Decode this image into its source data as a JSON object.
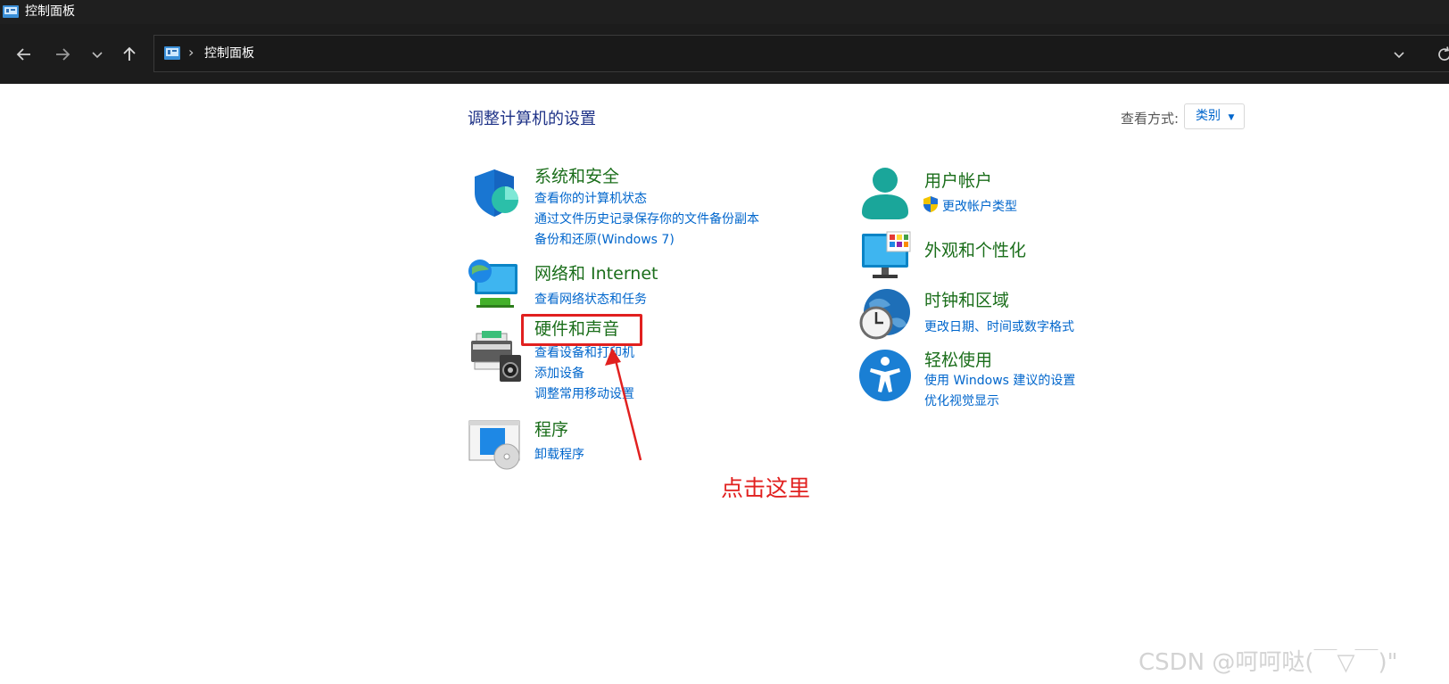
{
  "window": {
    "title": "控制面板"
  },
  "toolbar": {
    "back_icon": "arrow-left-icon",
    "forward_icon": "arrow-right-icon",
    "recent_icon": "chevron-down-icon",
    "up_icon": "arrow-up-icon"
  },
  "address": {
    "crumb": "控制面板"
  },
  "main": {
    "heading": "调整计算机的设置",
    "view_by_label": "查看方式:",
    "view_by_value": "类别"
  },
  "categories": {
    "system": {
      "title": "系统和安全",
      "links": [
        "查看你的计算机状态",
        "通过文件历史记录保存你的文件备份副本",
        "备份和还原(Windows 7)"
      ]
    },
    "network": {
      "title": "网络和 Internet",
      "links": [
        "查看网络状态和任务"
      ]
    },
    "hardware": {
      "title": "硬件和声音",
      "links": [
        "查看设备和打印机",
        "添加设备",
        "调整常用移动设置"
      ]
    },
    "programs": {
      "title": "程序",
      "links": [
        "卸载程序"
      ]
    },
    "accounts": {
      "title": "用户帐户",
      "links": [
        "更改帐户类型"
      ]
    },
    "appearance": {
      "title": "外观和个性化",
      "links": []
    },
    "clock": {
      "title": "时钟和区域",
      "links": [
        "更改日期、时间或数字格式"
      ]
    },
    "ease": {
      "title": "轻松使用",
      "links": [
        "使用 Windows 建议的设置",
        "优化视觉显示"
      ]
    }
  },
  "annotation": {
    "text": "点击这里"
  },
  "watermark": {
    "text": "CSDN @呵呵哒(￣▽￣)\""
  },
  "colors": {
    "category_title": "#1b6e1b",
    "link": "#0066cc",
    "heading": "#1e3287",
    "annotation": "#e1201f"
  }
}
